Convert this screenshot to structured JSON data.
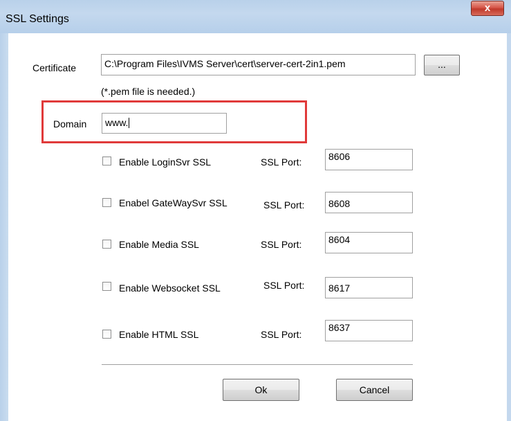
{
  "window": {
    "title": "SSL Settings",
    "close_label": "x"
  },
  "certificate": {
    "label": "Certificate",
    "value": "C:\\Program Files\\IVMS Server\\cert\\server-cert-2in1.pem",
    "browse_label": "...",
    "hint": "(*.pem file is needed.)"
  },
  "domain": {
    "label": "Domain",
    "value": "www."
  },
  "ssl_rows": [
    {
      "label": "Enable LoginSvr SSL",
      "checked": false,
      "port_label": "SSL Port:",
      "port": "8606"
    },
    {
      "label": "Enabel GateWaySvr SSL",
      "checked": false,
      "port_label": "SSL Port:",
      "port": "8608"
    },
    {
      "label": "Enable Media SSL",
      "checked": false,
      "port_label": "SSL Port:",
      "port": "8604"
    },
    {
      "label": "Enable Websocket SSL",
      "checked": false,
      "port_label": "SSL Port:",
      "port": "8617"
    },
    {
      "label": "Enable HTML SSL",
      "checked": false,
      "port_label": "SSL Port:",
      "port": "8637"
    }
  ],
  "buttons": {
    "ok_label": "Ok",
    "cancel_label": "Cancel"
  },
  "colors": {
    "highlight": "#e03a3a",
    "titlebar": "#b9d1ea"
  }
}
